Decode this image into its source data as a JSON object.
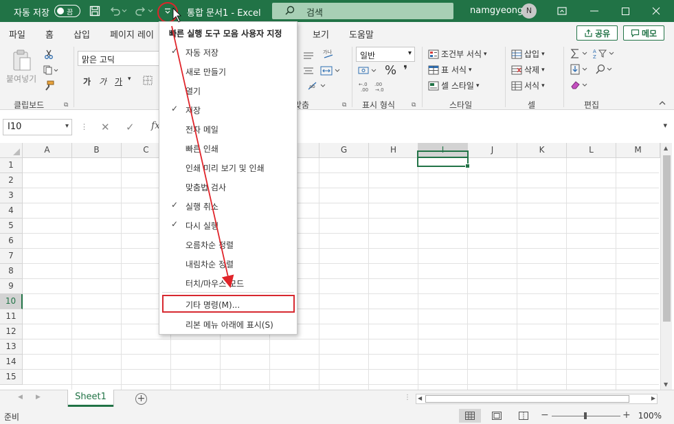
{
  "titlebar": {
    "autosave": "자동 저장",
    "toggle": "끔",
    "doc_title": "통합 문서1  -  Excel",
    "search_placeholder": "검색",
    "user_name": "namgyeong",
    "user_initial": "N"
  },
  "tabs": [
    "파일",
    "홈",
    "삽입",
    "페이지 레이",
    "보기",
    "도움말"
  ],
  "share_label": "공유",
  "memo_label": "메모",
  "ribbon": {
    "paste": "붙여넣기",
    "clipboard": "클립보드",
    "font_name": "맑은 고딕",
    "font_bold": "가",
    "font_italic": "가",
    "font_underline": "가",
    "align_label": "맞춤",
    "number_format": "일반",
    "number_label": "표시 형식",
    "cond_format": "조건부 서식",
    "table_format": "표 서식",
    "cell_style": "셀 스타일",
    "styles_label": "스타일",
    "insert": "삽입",
    "delete": "삭제",
    "format": "서식",
    "cells_label": "셀",
    "edit_label": "편집",
    "percent": "%",
    "comma": "❜"
  },
  "formula_bar": {
    "name_box": "I10",
    "fx": "fx"
  },
  "columns": [
    "A",
    "B",
    "C",
    "D",
    "E",
    "F",
    "G",
    "H",
    "I",
    "J",
    "K",
    "L",
    "M"
  ],
  "rows": [
    "1",
    "2",
    "3",
    "4",
    "5",
    "6",
    "7",
    "8",
    "9",
    "10",
    "11",
    "12",
    "13",
    "14",
    "15"
  ],
  "selected_col": "I",
  "selected_row": "10",
  "sheet_tab": "Sheet1",
  "status": "준비",
  "zoom": "100%",
  "menu": {
    "title": "빠른 실행 도구 모음 사용자 지정",
    "items": [
      {
        "label": "자동 저장",
        "checked": true
      },
      {
        "label": "새로 만들기",
        "checked": false
      },
      {
        "label": "열기",
        "checked": false
      },
      {
        "label": "저장",
        "checked": true
      },
      {
        "label": "전자 메일",
        "checked": false
      },
      {
        "label": "빠른 인쇄",
        "checked": false
      },
      {
        "label": "인쇄 미리 보기 및 인쇄",
        "checked": false
      },
      {
        "label": "맞춤법 검사",
        "checked": false
      },
      {
        "label": "실행 취소",
        "checked": true
      },
      {
        "label": "다시 실행",
        "checked": true
      },
      {
        "label": "오름차순 정렬",
        "checked": false
      },
      {
        "label": "내림차순 정렬",
        "checked": false
      },
      {
        "label": "터치/마우스 모드",
        "checked": false
      }
    ],
    "more_commands": "기타 명령(M)...",
    "show_below": "리본 메뉴 아래에 표시(S)"
  },
  "colors": {
    "excel_green": "#217346",
    "annotation_red": "#e0242a"
  }
}
